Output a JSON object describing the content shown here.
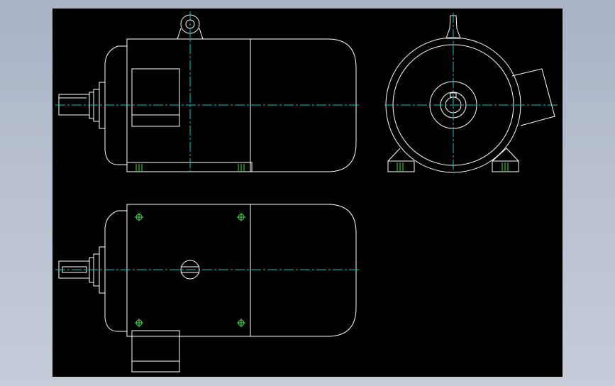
{
  "drawing": {
    "background": "#000000",
    "outline_color": "#ffffff",
    "centerline_color": "#00c8c8",
    "hole_marker_color": "#39e639",
    "views": [
      "front-view",
      "side-view",
      "top-view"
    ]
  }
}
